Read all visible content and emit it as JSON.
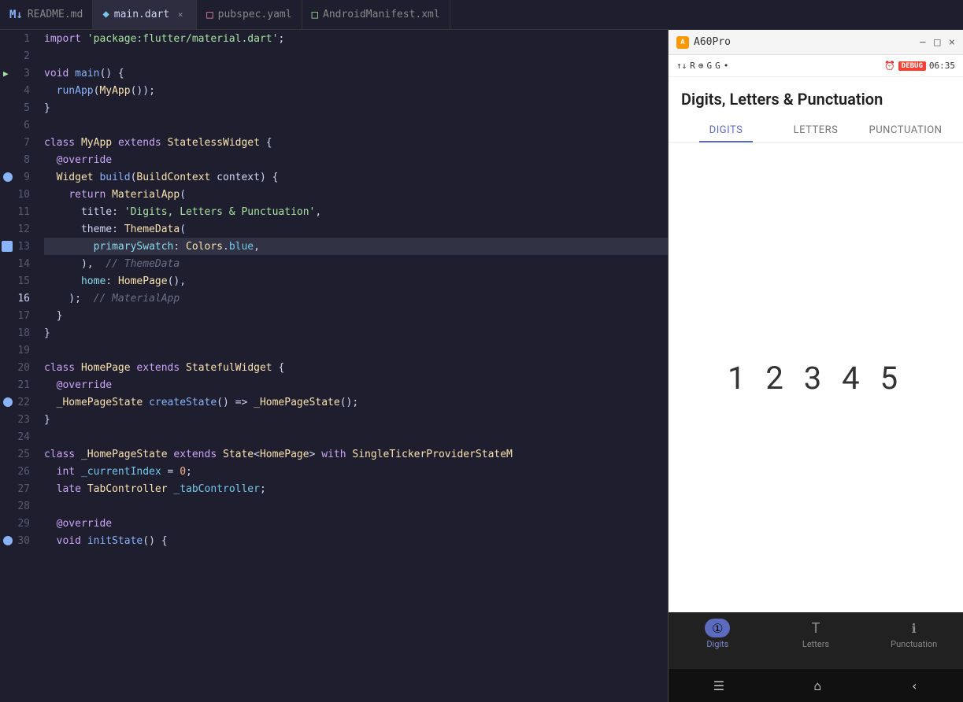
{
  "tabs": [
    {
      "id": "readme",
      "label": "README.md",
      "icon": "M↓",
      "icon_class": "tab-icon-md",
      "active": false,
      "closable": false
    },
    {
      "id": "main_dart",
      "label": "main.dart",
      "icon": "◆",
      "icon_class": "tab-icon-dart",
      "active": true,
      "closable": true
    },
    {
      "id": "pubspec",
      "label": "pubspec.yaml",
      "icon": "□",
      "icon_class": "tab-icon-yaml",
      "active": false,
      "closable": false
    },
    {
      "id": "android_manifest",
      "label": "AndroidManifest.xml",
      "icon": "□",
      "icon_class": "tab-icon-xml",
      "active": false,
      "closable": false
    }
  ],
  "code_lines": [
    {
      "num": 1,
      "content": "import 'package:flutter/material.dart';",
      "highlight": false
    },
    {
      "num": 2,
      "content": "",
      "highlight": false
    },
    {
      "num": 3,
      "content": "void main() {",
      "highlight": false,
      "has_run_arrow": true
    },
    {
      "num": 4,
      "content": "  runApp(MyApp());",
      "highlight": false
    },
    {
      "num": 5,
      "content": "}",
      "highlight": false
    },
    {
      "num": 6,
      "content": "",
      "highlight": false
    },
    {
      "num": 7,
      "content": "class MyApp extends StatelessWidget {",
      "highlight": false
    },
    {
      "num": 8,
      "content": "  @override",
      "highlight": false
    },
    {
      "num": 9,
      "content": "  Widget build(BuildContext context) {",
      "highlight": false,
      "has_debug_dot": true
    },
    {
      "num": 10,
      "content": "    return MaterialApp(",
      "highlight": false
    },
    {
      "num": 11,
      "content": "      title: 'Digits, Letters & Punctuation',",
      "highlight": false
    },
    {
      "num": 12,
      "content": "      theme: ThemeData(",
      "highlight": false
    },
    {
      "num": 13,
      "content": "        primarySwatch: Colors.blue,",
      "highlight": true,
      "has_breakpoint": true
    },
    {
      "num": 14,
      "content": "      ),  // ThemeData",
      "highlight": false
    },
    {
      "num": 15,
      "content": "      home: HomePage(),",
      "highlight": false
    },
    {
      "num": 16,
      "content": "    );  // MaterialApp",
      "highlight": false,
      "is_active": true
    },
    {
      "num": 17,
      "content": "  }",
      "highlight": false
    },
    {
      "num": 18,
      "content": "}",
      "highlight": false
    },
    {
      "num": 19,
      "content": "",
      "highlight": false
    },
    {
      "num": 20,
      "content": "class HomePage extends StatefulWidget {",
      "highlight": false
    },
    {
      "num": 21,
      "content": "  @override",
      "highlight": false
    },
    {
      "num": 22,
      "content": "  _HomePageState createState() => _HomePageState();",
      "highlight": false,
      "has_debug_dot": true
    },
    {
      "num": 23,
      "content": "}",
      "highlight": false
    },
    {
      "num": 24,
      "content": "",
      "highlight": false
    },
    {
      "num": 25,
      "content": "class _HomePageState extends State<HomePage> with SingleTickerProviderState",
      "highlight": false
    },
    {
      "num": 26,
      "content": "  int _currentIndex = 0;",
      "highlight": false
    },
    {
      "num": 27,
      "content": "  late TabController _tabController;",
      "highlight": false
    },
    {
      "num": 28,
      "content": "",
      "highlight": false
    },
    {
      "num": 29,
      "content": "  @override",
      "highlight": false
    },
    {
      "num": 30,
      "content": "  void initState() {",
      "highlight": false,
      "has_debug_dot": true
    }
  ],
  "phone": {
    "title_bar": {
      "device_name": "A60Pro",
      "min_label": "−",
      "max_label": "□",
      "close_label": "×"
    },
    "status_bar": {
      "signal": "↑↓R ⊕ ☁",
      "google1": "G",
      "google2": "G",
      "dot": "•",
      "battery": "06:35",
      "alarm": "⏰",
      "debug_label": "DEBUG"
    },
    "app": {
      "title": "Digits, Letters & Punctuation",
      "tabs": [
        {
          "id": "digits",
          "label": "Digits",
          "active": true
        },
        {
          "id": "letters",
          "label": "Letters",
          "active": false
        },
        {
          "id": "punctuation",
          "label": "Punctuation",
          "active": false
        }
      ],
      "digits_content": "1 2 3 4 5"
    },
    "bottom_nav": [
      {
        "id": "digits_nav",
        "icon": "①",
        "label": "Digits",
        "active": true
      },
      {
        "id": "letters_nav",
        "icon": "T̈",
        "label": "Letters",
        "active": false
      },
      {
        "id": "punctuation_nav",
        "icon": "ℹ",
        "label": "Punctuation",
        "active": false
      }
    ],
    "android_nav": {
      "menu": "☰",
      "home": "⌂",
      "back": "‹"
    }
  }
}
